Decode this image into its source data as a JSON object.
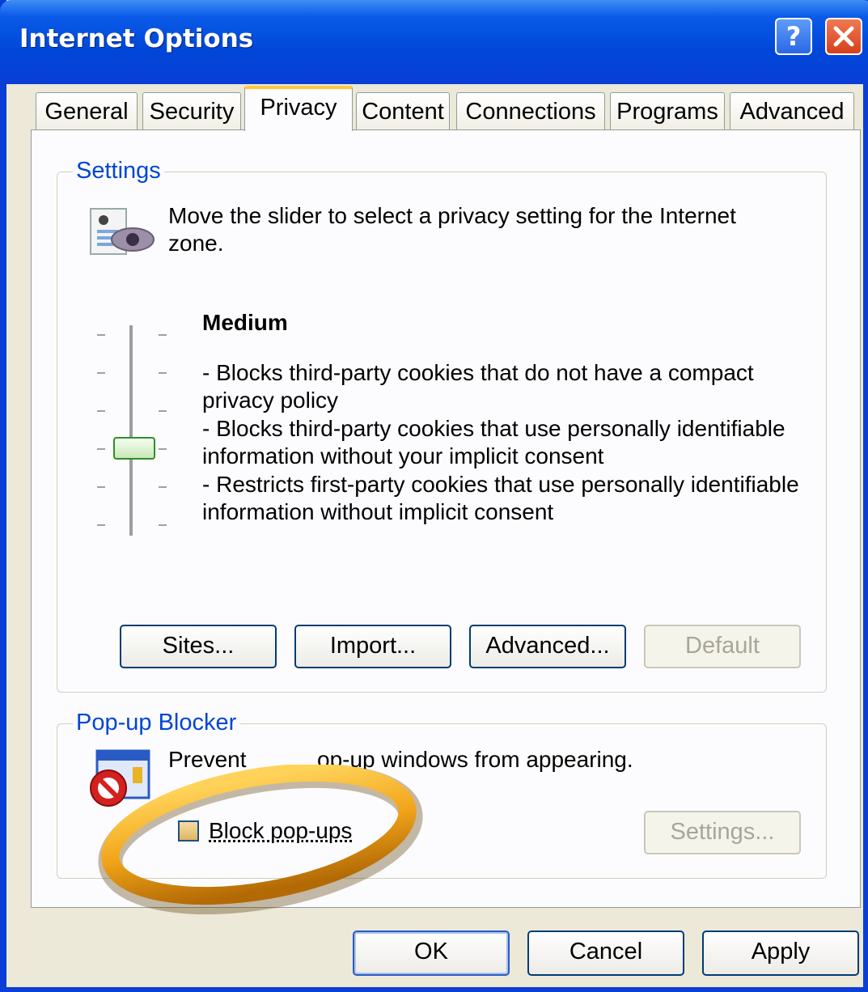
{
  "window": {
    "title": "Internet Options"
  },
  "tabs": [
    {
      "label": "General"
    },
    {
      "label": "Security"
    },
    {
      "label": "Privacy",
      "active": true
    },
    {
      "label": "Content"
    },
    {
      "label": "Connections"
    },
    {
      "label": "Programs"
    },
    {
      "label": "Advanced"
    }
  ],
  "settings": {
    "group_label": "Settings",
    "description_line1": "Move the slider to select a privacy setting for the Internet",
    "description_line2": "zone.",
    "level_name": "Medium",
    "level_details": [
      "- Blocks third-party cookies that do not have a compact",
      "privacy policy",
      "- Blocks third-party cookies that use personally identifiable",
      "information without your implicit consent",
      "- Restricts first-party cookies that use personally identifiable",
      "information without implicit consent"
    ],
    "slider_level_index": 3,
    "slider_level_count": 6,
    "buttons": {
      "sites": "Sites...",
      "import": "Import...",
      "advanced": "Advanced...",
      "default": "Default"
    }
  },
  "popup_blocker": {
    "group_label": "Pop-up Blocker",
    "description_visible_a": "Prevent",
    "description_visible_b": "op-up windows from appearing.",
    "checkbox_label": "Block pop-ups",
    "checkbox_checked": false,
    "settings_button": "Settings..."
  },
  "footer": {
    "ok": "OK",
    "cancel": "Cancel",
    "apply": "Apply"
  },
  "colors": {
    "titlebar": "#0a3ed6",
    "group_label": "#0046d5",
    "active_tab_accent": "#ffc73c",
    "highlight_ring": "#f2a51a"
  }
}
